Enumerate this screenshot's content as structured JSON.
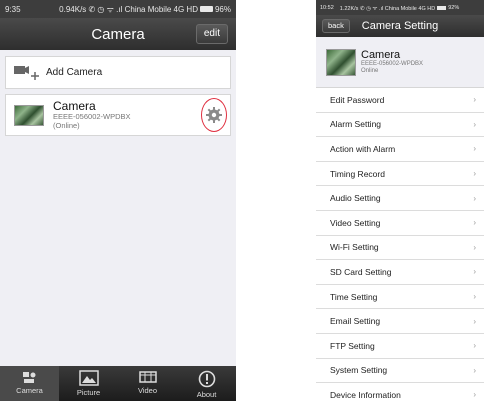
{
  "left": {
    "status": {
      "time": "9:35",
      "info": "0.94K/s ✆ ◷ ᯤ .ıl China Mobile 4G HD",
      "battery": "96%"
    },
    "title": "Camera",
    "edit_label": "edit",
    "add_camera_label": "Add Camera",
    "camera": {
      "name": "Camera",
      "id": "EEEE-056002-WPDBX",
      "status": "(Online)"
    },
    "tabs": [
      {
        "label": "Camera",
        "icon": "camera-icon"
      },
      {
        "label": "Picture",
        "icon": "picture-icon"
      },
      {
        "label": "Video",
        "icon": "video-icon"
      },
      {
        "label": "About",
        "icon": "about-icon"
      }
    ]
  },
  "right": {
    "status": {
      "time": "10:52",
      "info": "1.22K/s ✆ ◷ ᯤ .ıl China Mobile 4G HD",
      "battery": "92%"
    },
    "back_label": "back",
    "title": "Camera Setting",
    "camera": {
      "name": "Camera",
      "id": "EEEE-056002-WPDBX",
      "status": "Online"
    },
    "settings": [
      "Edit Password",
      "Alarm Setting",
      "Action with Alarm",
      "Timing Record",
      "Audio Setting",
      "Video Setting",
      "Wi-Fi Setting",
      "SD Card Setting",
      "Time Setting",
      "Email Setting",
      "FTP Setting",
      "System Setting",
      "Device Information"
    ],
    "chevron": "›"
  },
  "colors": {
    "nav_dark": "#2e2e2e",
    "highlight_circle": "#e03040",
    "background": "#efeff4"
  }
}
